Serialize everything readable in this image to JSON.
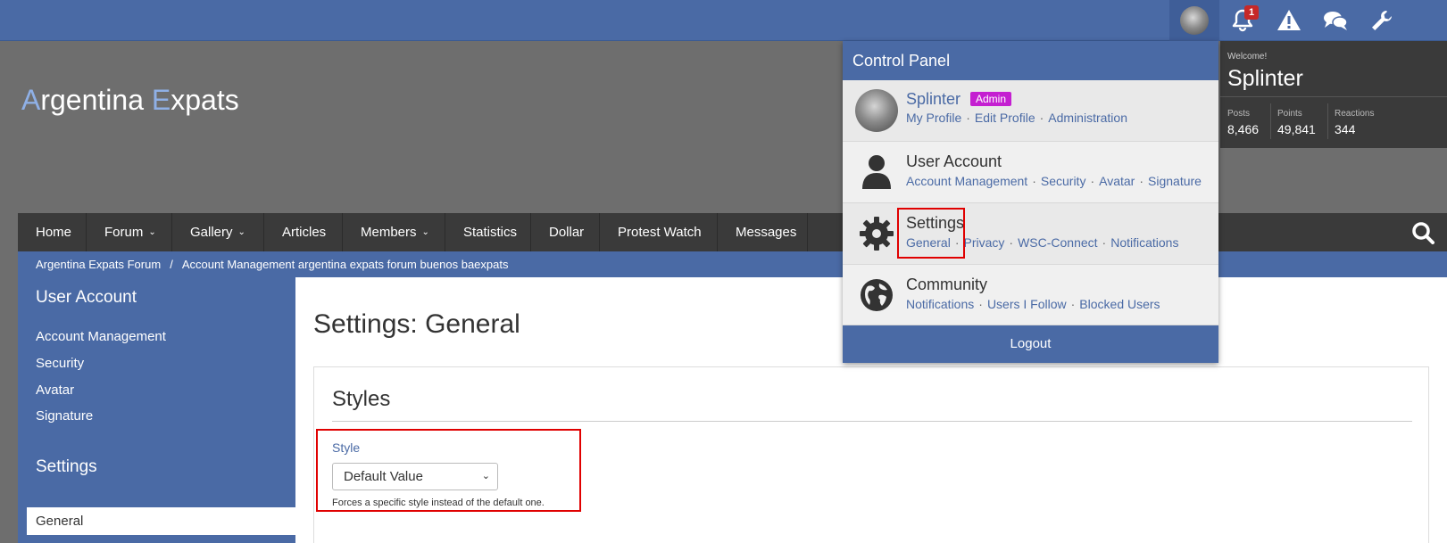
{
  "site": {
    "logo_first_initial": "A",
    "logo_first_rest": "rgentina ",
    "logo_second_initial": "E",
    "logo_second_rest": "xpats"
  },
  "topbar": {
    "notification_count": "1",
    "accent_color": "#4a6aa5",
    "badge_color": "#c62828"
  },
  "nav": {
    "items": [
      {
        "label": "Home",
        "dropdown": false
      },
      {
        "label": "Forum",
        "dropdown": true
      },
      {
        "label": "Gallery",
        "dropdown": true
      },
      {
        "label": "Articles",
        "dropdown": false
      },
      {
        "label": "Members",
        "dropdown": true
      },
      {
        "label": "Statistics",
        "dropdown": false
      },
      {
        "label": "Dollar",
        "dropdown": false
      },
      {
        "label": "Protest Watch",
        "dropdown": false
      },
      {
        "label": "Messages",
        "dropdown": false
      }
    ],
    "caret": "⌄"
  },
  "breadcrumb": {
    "items": [
      "Argentina Expats Forum",
      "Account Management argentina expats forum buenos baexpats"
    ],
    "separator": "/"
  },
  "sidebar": {
    "user_account_heading": "User Account",
    "user_account_links": [
      "Account Management",
      "Security",
      "Avatar",
      "Signature"
    ],
    "settings_heading": "Settings",
    "settings_active": "General"
  },
  "main": {
    "title": "Settings: General",
    "section_title": "Styles",
    "field_label": "Style",
    "select_value": "Default Value",
    "field_description": "Forces a specific style instead of the default one."
  },
  "userbox": {
    "welcome": "Welcome!",
    "username": "Splinter",
    "stats": [
      {
        "label": "Posts",
        "value": "8,466"
      },
      {
        "label": "Points",
        "value": "49,841"
      },
      {
        "label": "Reactions",
        "value": "344"
      }
    ]
  },
  "control_panel": {
    "title": "Control Panel",
    "user": {
      "name": "Splinter",
      "badge": "Admin",
      "links": [
        "My Profile",
        "Edit Profile",
        "Administration"
      ]
    },
    "user_account": {
      "title": "User Account",
      "links": [
        "Account Management",
        "Security",
        "Avatar",
        "Signature"
      ]
    },
    "settings": {
      "title": "Settings",
      "links": [
        "General",
        "Privacy",
        "WSC-Connect",
        "Notifications"
      ]
    },
    "community": {
      "title": "Community",
      "links": [
        "Notifications",
        "Users I Follow",
        "Blocked Users"
      ]
    },
    "logout": "Logout",
    "link_separator": "·"
  }
}
